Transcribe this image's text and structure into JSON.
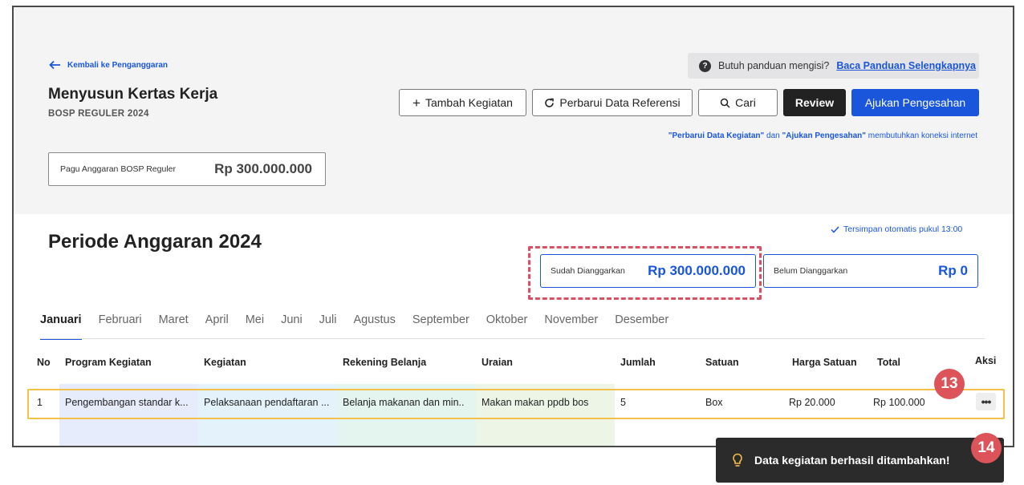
{
  "header": {
    "back_label": "Kembali ke Penganggaran",
    "title": "Menyusun Kertas Kerja",
    "subtitle": "BOSP REGULER 2024"
  },
  "pagu": {
    "label": "Pagu Anggaran BOSP Reguler",
    "value": "Rp 300.000.000"
  },
  "help": {
    "text": "Butuh panduan mengisi?",
    "link": "Baca Panduan Selengkapnya"
  },
  "toolbar": {
    "add_label": "Tambah Kegiatan",
    "refresh_label": "Perbarui Data Referensi",
    "search_label": "Cari",
    "review_label": "Review",
    "submit_label": "Ajukan Pengesahan"
  },
  "note": {
    "part1": "\"Perbarui Data Kegiatan\"",
    "part2": " dan ",
    "part3": "\"Ajukan Pengesahan\"",
    "part4": " membutuhkan koneksi internet"
  },
  "period": {
    "title": "Periode Anggaran 2024",
    "autosave": "Tersimpan otomatis pukul 13:00",
    "budgeted_label": "Sudah Dianggarkan",
    "budgeted_value": "Rp 300.000.000",
    "unbudgeted_label": "Belum Dianggarkan",
    "unbudgeted_value": "Rp 0"
  },
  "tabs": [
    "Januari",
    "Februari",
    "Maret",
    "April",
    "Mei",
    "Juni",
    "Juli",
    "Agustus",
    "September",
    "Oktober",
    "November",
    "Desember"
  ],
  "table": {
    "headers": [
      "No",
      "Program Kegiatan",
      "Kegiatan",
      "Rekening Belanja",
      "Uraian",
      "Jumlah",
      "Satuan",
      "Harga Satuan",
      "Total",
      "Aksi"
    ],
    "rows": [
      [
        "1",
        "Pengembangan standar k...",
        "Pelaksanaan pendaftaran ...",
        "Belanja makanan dan min..",
        "Makan makan ppdb bos",
        "5",
        "Box",
        "Rp 20.000",
        "Rp 100.000"
      ]
    ],
    "action_label": "•••"
  },
  "markers": {
    "m13": "13",
    "m14": "14"
  },
  "toast": {
    "message": "Data kegiatan berhasil ditambahkan!"
  },
  "colors": {
    "accent": "#1a56db",
    "highlight_dashed": "#d94f64",
    "row_highlight": "#f5c04a",
    "marker": "#dc5359",
    "toast_bg": "#2b2b2b"
  }
}
